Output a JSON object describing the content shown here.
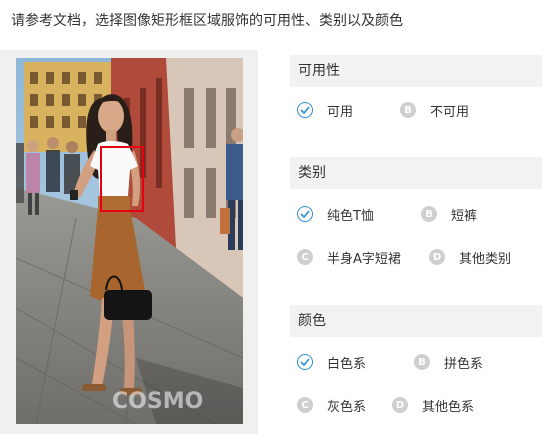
{
  "instruction": "请参考文档，选择图像矩形框区域服饰的可用性、类别以及颜色",
  "colors": {
    "check": "#2b8fd6",
    "bbox": "#e60012",
    "header_bg": "#f2f2f2",
    "photo_panel_bg": "#f0f0f0",
    "letter_circle": "#cfcfcf"
  },
  "sections": {
    "usability": {
      "title": "可用性",
      "options": [
        {
          "marker": "✓",
          "label": "可用",
          "selected": true
        },
        {
          "marker": "B",
          "label": "不可用",
          "selected": false
        }
      ]
    },
    "category": {
      "title": "类别",
      "options": [
        {
          "marker": "✓",
          "label": "纯色T恤",
          "selected": true
        },
        {
          "marker": "B",
          "label": "短裤",
          "selected": false
        },
        {
          "marker": "C",
          "label": "半身A字短裙",
          "selected": false
        },
        {
          "marker": "D",
          "label": "其他类别",
          "selected": false
        }
      ]
    },
    "color": {
      "title": "颜色",
      "options": [
        {
          "marker": "✓",
          "label": "白色系",
          "selected": true
        },
        {
          "marker": "B",
          "label": "拼色系",
          "selected": false
        },
        {
          "marker": "C",
          "label": "灰色系",
          "selected": false
        },
        {
          "marker": "D",
          "label": "其他色系",
          "selected": false
        }
      ]
    }
  },
  "photo": {
    "watermark": "COSMO"
  }
}
